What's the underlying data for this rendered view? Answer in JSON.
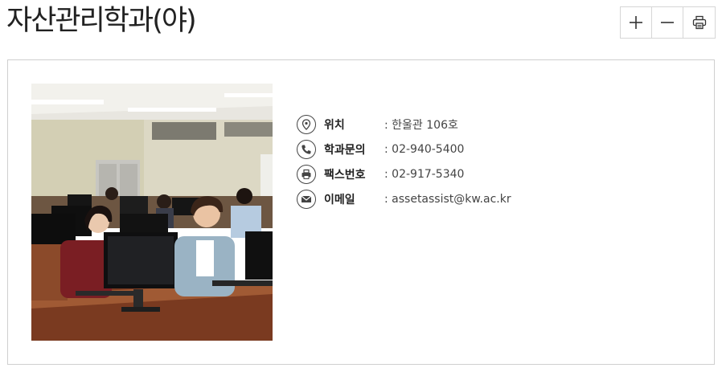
{
  "page": {
    "title": "자산관리학과(야)"
  },
  "toolbar": {
    "zoom_in_icon": "plus-icon",
    "zoom_out_icon": "minus-icon",
    "print_icon": "printer-icon"
  },
  "contacts": [
    {
      "icon": "location-pin-icon",
      "label": "위치",
      "value": ": 한울관 106호"
    },
    {
      "icon": "phone-icon",
      "label": "학과문의",
      "value": ": 02-940-5400"
    },
    {
      "icon": "fax-icon",
      "label": "팩스번호",
      "value": ": 02-917-5340"
    },
    {
      "icon": "mail-icon",
      "label": "이메일",
      "value": ": assetassist@kw.ac.kr"
    }
  ]
}
